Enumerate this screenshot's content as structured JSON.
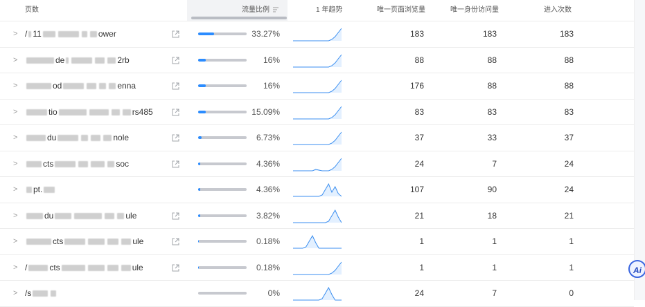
{
  "header": {
    "page": "页数",
    "share": "流量比例",
    "trend": "1 年趋势",
    "unique_views": "唯一页面浏览量",
    "unique_visitors": "唯一身份访问量",
    "entries": "进入次数",
    "sort_icon": "sort-desc-icon"
  },
  "rows": [
    {
      "prefix": "/",
      "suffix": "ower",
      "segs": [
        4,
        18,
        30,
        8,
        10
      ],
      "mid": "11",
      "external": true,
      "share": 33.27,
      "share_label": "33.27%",
      "trend": [
        0,
        0,
        0,
        0,
        0,
        0,
        0,
        0,
        0,
        0,
        0,
        0,
        2,
        6,
        12,
        18
      ],
      "uv": "183",
      "uu": "183",
      "en": "183"
    },
    {
      "prefix": "",
      "suffix": "2rb",
      "segs": [
        40,
        4,
        30,
        14,
        12
      ],
      "mid": "de",
      "external": true,
      "share": 16,
      "share_label": "16%",
      "trend": [
        0,
        0,
        0,
        0,
        0,
        0,
        0,
        0,
        0,
        0,
        0,
        0,
        2,
        6,
        12,
        18
      ],
      "uv": "88",
      "uu": "88",
      "en": "88"
    },
    {
      "prefix": "",
      "suffix": "enna",
      "segs": [
        36,
        30,
        14,
        10,
        10
      ],
      "mid": "od",
      "external": true,
      "share": 16,
      "share_label": "16%",
      "trend": [
        0,
        0,
        0,
        0,
        0,
        0,
        0,
        0,
        0,
        0,
        0,
        0,
        2,
        6,
        12,
        18
      ],
      "uv": "176",
      "uu": "88",
      "en": "88"
    },
    {
      "prefix": "",
      "suffix": "rs485",
      "segs": [
        30,
        40,
        28,
        12,
        12
      ],
      "mid": "tio",
      "external": true,
      "share": 15.09,
      "share_label": "15.09%",
      "trend": [
        0,
        0,
        0,
        0,
        0,
        0,
        0,
        0,
        0,
        0,
        0,
        0,
        2,
        6,
        12,
        18
      ],
      "uv": "83",
      "uu": "83",
      "en": "83"
    },
    {
      "prefix": "",
      "suffix": "nole",
      "segs": [
        28,
        30,
        10,
        14,
        12
      ],
      "mid": "du",
      "external": true,
      "share": 6.73,
      "share_label": "6.73%",
      "trend": [
        0,
        0,
        0,
        0,
        0,
        0,
        0,
        0,
        0,
        0,
        0,
        0,
        2,
        6,
        12,
        18
      ],
      "uv": "37",
      "uu": "33",
      "en": "37"
    },
    {
      "prefix": "",
      "suffix": "soc",
      "segs": [
        22,
        30,
        14,
        20,
        10
      ],
      "mid": "cts",
      "external": true,
      "share": 4.36,
      "share_label": "4.36%",
      "trend": [
        0,
        0,
        0,
        0,
        0,
        0,
        0,
        2,
        1,
        0,
        0,
        0,
        2,
        6,
        12,
        18
      ],
      "uv": "24",
      "uu": "7",
      "en": "24"
    },
    {
      "prefix": "",
      "suffix": "",
      "segs": [
        8,
        0,
        16,
        0,
        0
      ],
      "mid": "pt.",
      "external": false,
      "share": 4.36,
      "share_label": "4.36%",
      "trend": [
        0,
        0,
        0,
        0,
        0,
        0,
        0,
        0,
        0,
        2,
        10,
        18,
        6,
        14,
        4,
        0
      ],
      "uv": "107",
      "uu": "90",
      "en": "24"
    },
    {
      "prefix": "",
      "suffix": "ule",
      "segs": [
        24,
        24,
        40,
        14,
        10
      ],
      "mid": "du",
      "external": true,
      "share": 3.82,
      "share_label": "3.82%",
      "trend": [
        0,
        0,
        0,
        0,
        0,
        0,
        0,
        0,
        0,
        0,
        0,
        2,
        10,
        18,
        8,
        0
      ],
      "uv": "21",
      "uu": "18",
      "en": "21"
    },
    {
      "prefix": "",
      "suffix": "ule",
      "segs": [
        36,
        30,
        24,
        16,
        14
      ],
      "mid": "cts",
      "external": true,
      "share": 0.18,
      "share_label": "0.18%",
      "trend": [
        0,
        0,
        0,
        0,
        2,
        10,
        18,
        8,
        0,
        0,
        0,
        0,
        0,
        0,
        0,
        0
      ],
      "uv": "1",
      "uu": "1",
      "en": "1"
    },
    {
      "prefix": "/",
      "suffix": "ule",
      "segs": [
        28,
        34,
        24,
        16,
        14
      ],
      "mid": "cts",
      "external": true,
      "share": 0.18,
      "share_label": "0.18%",
      "trend": [
        0,
        0,
        0,
        0,
        0,
        0,
        0,
        0,
        0,
        0,
        0,
        0,
        2,
        6,
        12,
        18
      ],
      "uv": "1",
      "uu": "1",
      "en": "1"
    },
    {
      "prefix": "/s",
      "suffix": "",
      "segs": [
        22,
        0,
        8,
        0,
        0
      ],
      "mid": "",
      "external": false,
      "share": 0,
      "share_label": "0%",
      "trend": [
        0,
        0,
        0,
        0,
        0,
        0,
        0,
        0,
        0,
        2,
        10,
        18,
        8,
        0,
        0,
        0
      ],
      "uv": "24",
      "uu": "7",
      "en": "0"
    }
  ],
  "ai_button": "Ai"
}
